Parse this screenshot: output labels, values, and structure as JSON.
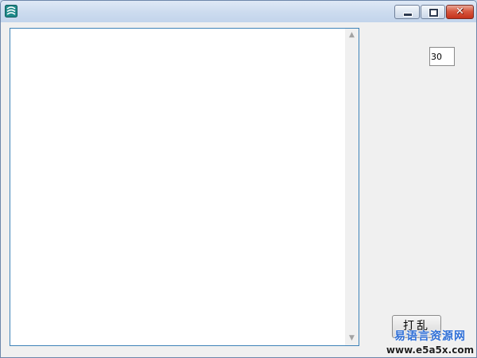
{
  "window": {
    "icon": "app-icon",
    "buttons": {
      "minimize": "minimize-icon",
      "maximize": "maximize-icon",
      "close": "✕"
    }
  },
  "memo": {
    "value": "",
    "scroll_up": "▲",
    "scroll_down": "▼"
  },
  "count_input": {
    "value": "30"
  },
  "shuffle_button": {
    "label": "打乱"
  },
  "watermark": {
    "line1": "易语言资源网",
    "line2": "www.e5a5x.com"
  },
  "colors": {
    "memo_border": "#3e83b8",
    "watermark": "#2f6fd6",
    "close_button": "#c4321b"
  }
}
